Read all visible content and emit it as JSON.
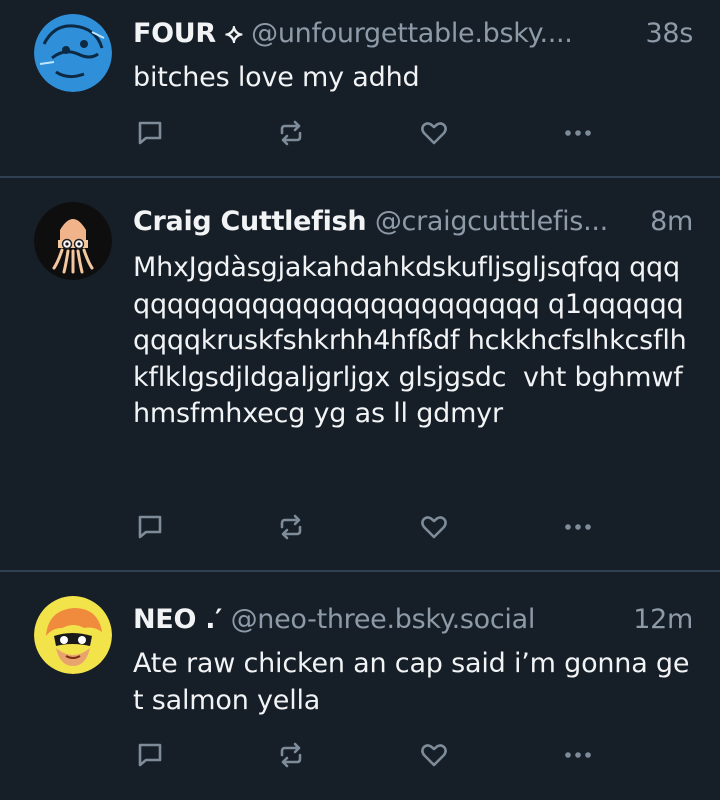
{
  "theme": {
    "background": "#161e27",
    "divider": "#2e4052",
    "text_primary": "#f1f3f5",
    "text_secondary": "#8d9aa8",
    "icon_color": "#7e8c9a"
  },
  "posts": [
    {
      "display_name": "FOUR ⟡",
      "handle": "@unfourgettable.bsky....",
      "time": "38s",
      "text": "bitches love my adhd",
      "avatar": "blue-sketch-avatar"
    },
    {
      "display_name": "Craig Cuttlefish",
      "handle": "@craigcutttlefis...",
      "time": "8m",
      "text": "MhxJgdàsgjakahdahkdskufljsgljsqfqq qqqqqqqqqqqqqqqqqqqqqqqqqqq q1qqqqqqqqqqkruskfshkrhh4hfßdf hckkhcfslhkcsflhkflklgsdjldgaljgrljgx glsjgsdc  vht bghmwfhmsfmhxecg yg as ll gdmyr",
      "avatar": "cuttlefish-avatar"
    },
    {
      "display_name": "NEO .′",
      "handle": "@neo-three.bsky.social",
      "time": "12m",
      "text": "Ate raw chicken an cap said i’m gonna get salmon yella",
      "avatar": "inkling-avatar"
    }
  ],
  "icons": {
    "reply": "reply-icon",
    "repost": "repost-icon",
    "like": "heart-icon",
    "more": "more-dots-icon"
  }
}
